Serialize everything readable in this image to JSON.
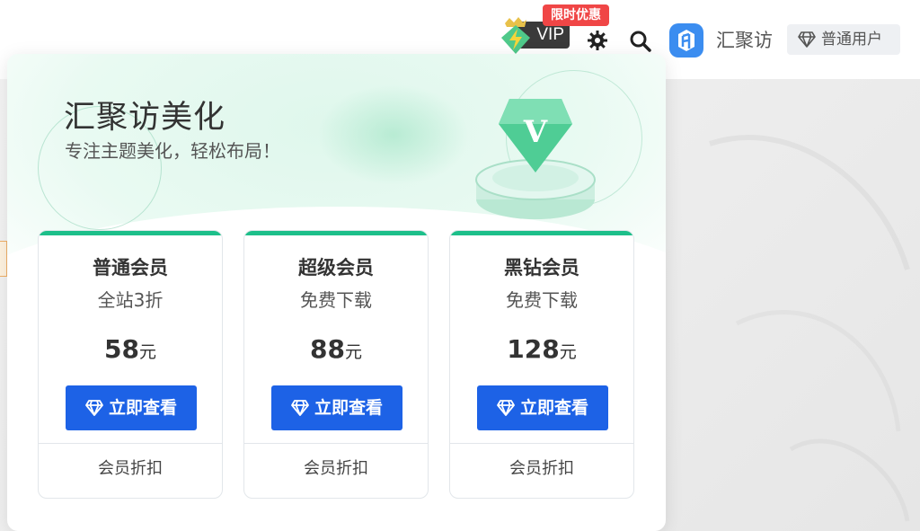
{
  "header": {
    "vip_label": "VIP",
    "promo_tag": "限时优惠",
    "site_name": "汇聚访",
    "user_level": "普通用户"
  },
  "icons": {
    "vip": "lightning-crown-icon",
    "settings": "gear-icon",
    "search": "search-icon",
    "logo": "site-logo-icon",
    "user_level": "diamond-icon",
    "button": "diamond-icon"
  },
  "panel": {
    "title": "汇聚访美化",
    "subtitle": "专注主题美化，轻松布局！",
    "emblem_letter": "V",
    "plans": [
      {
        "name": "普通会员",
        "desc": "全站3折",
        "price": "58",
        "unit": "元",
        "button": "立即查看",
        "footer": "会员折扣"
      },
      {
        "name": "超级会员",
        "desc": "免费下载",
        "price": "88",
        "unit": "元",
        "button": "立即查看",
        "footer": "会员折扣"
      },
      {
        "name": "黑钻会员",
        "desc": "免费下载",
        "price": "128",
        "unit": "元",
        "button": "立即查看",
        "footer": "会员折扣"
      }
    ]
  },
  "colors": {
    "accent_green": "#1dbf8a",
    "button_blue": "#1d62e6",
    "promo_red": "#f04646",
    "vip_dark": "#3a3a3a"
  }
}
